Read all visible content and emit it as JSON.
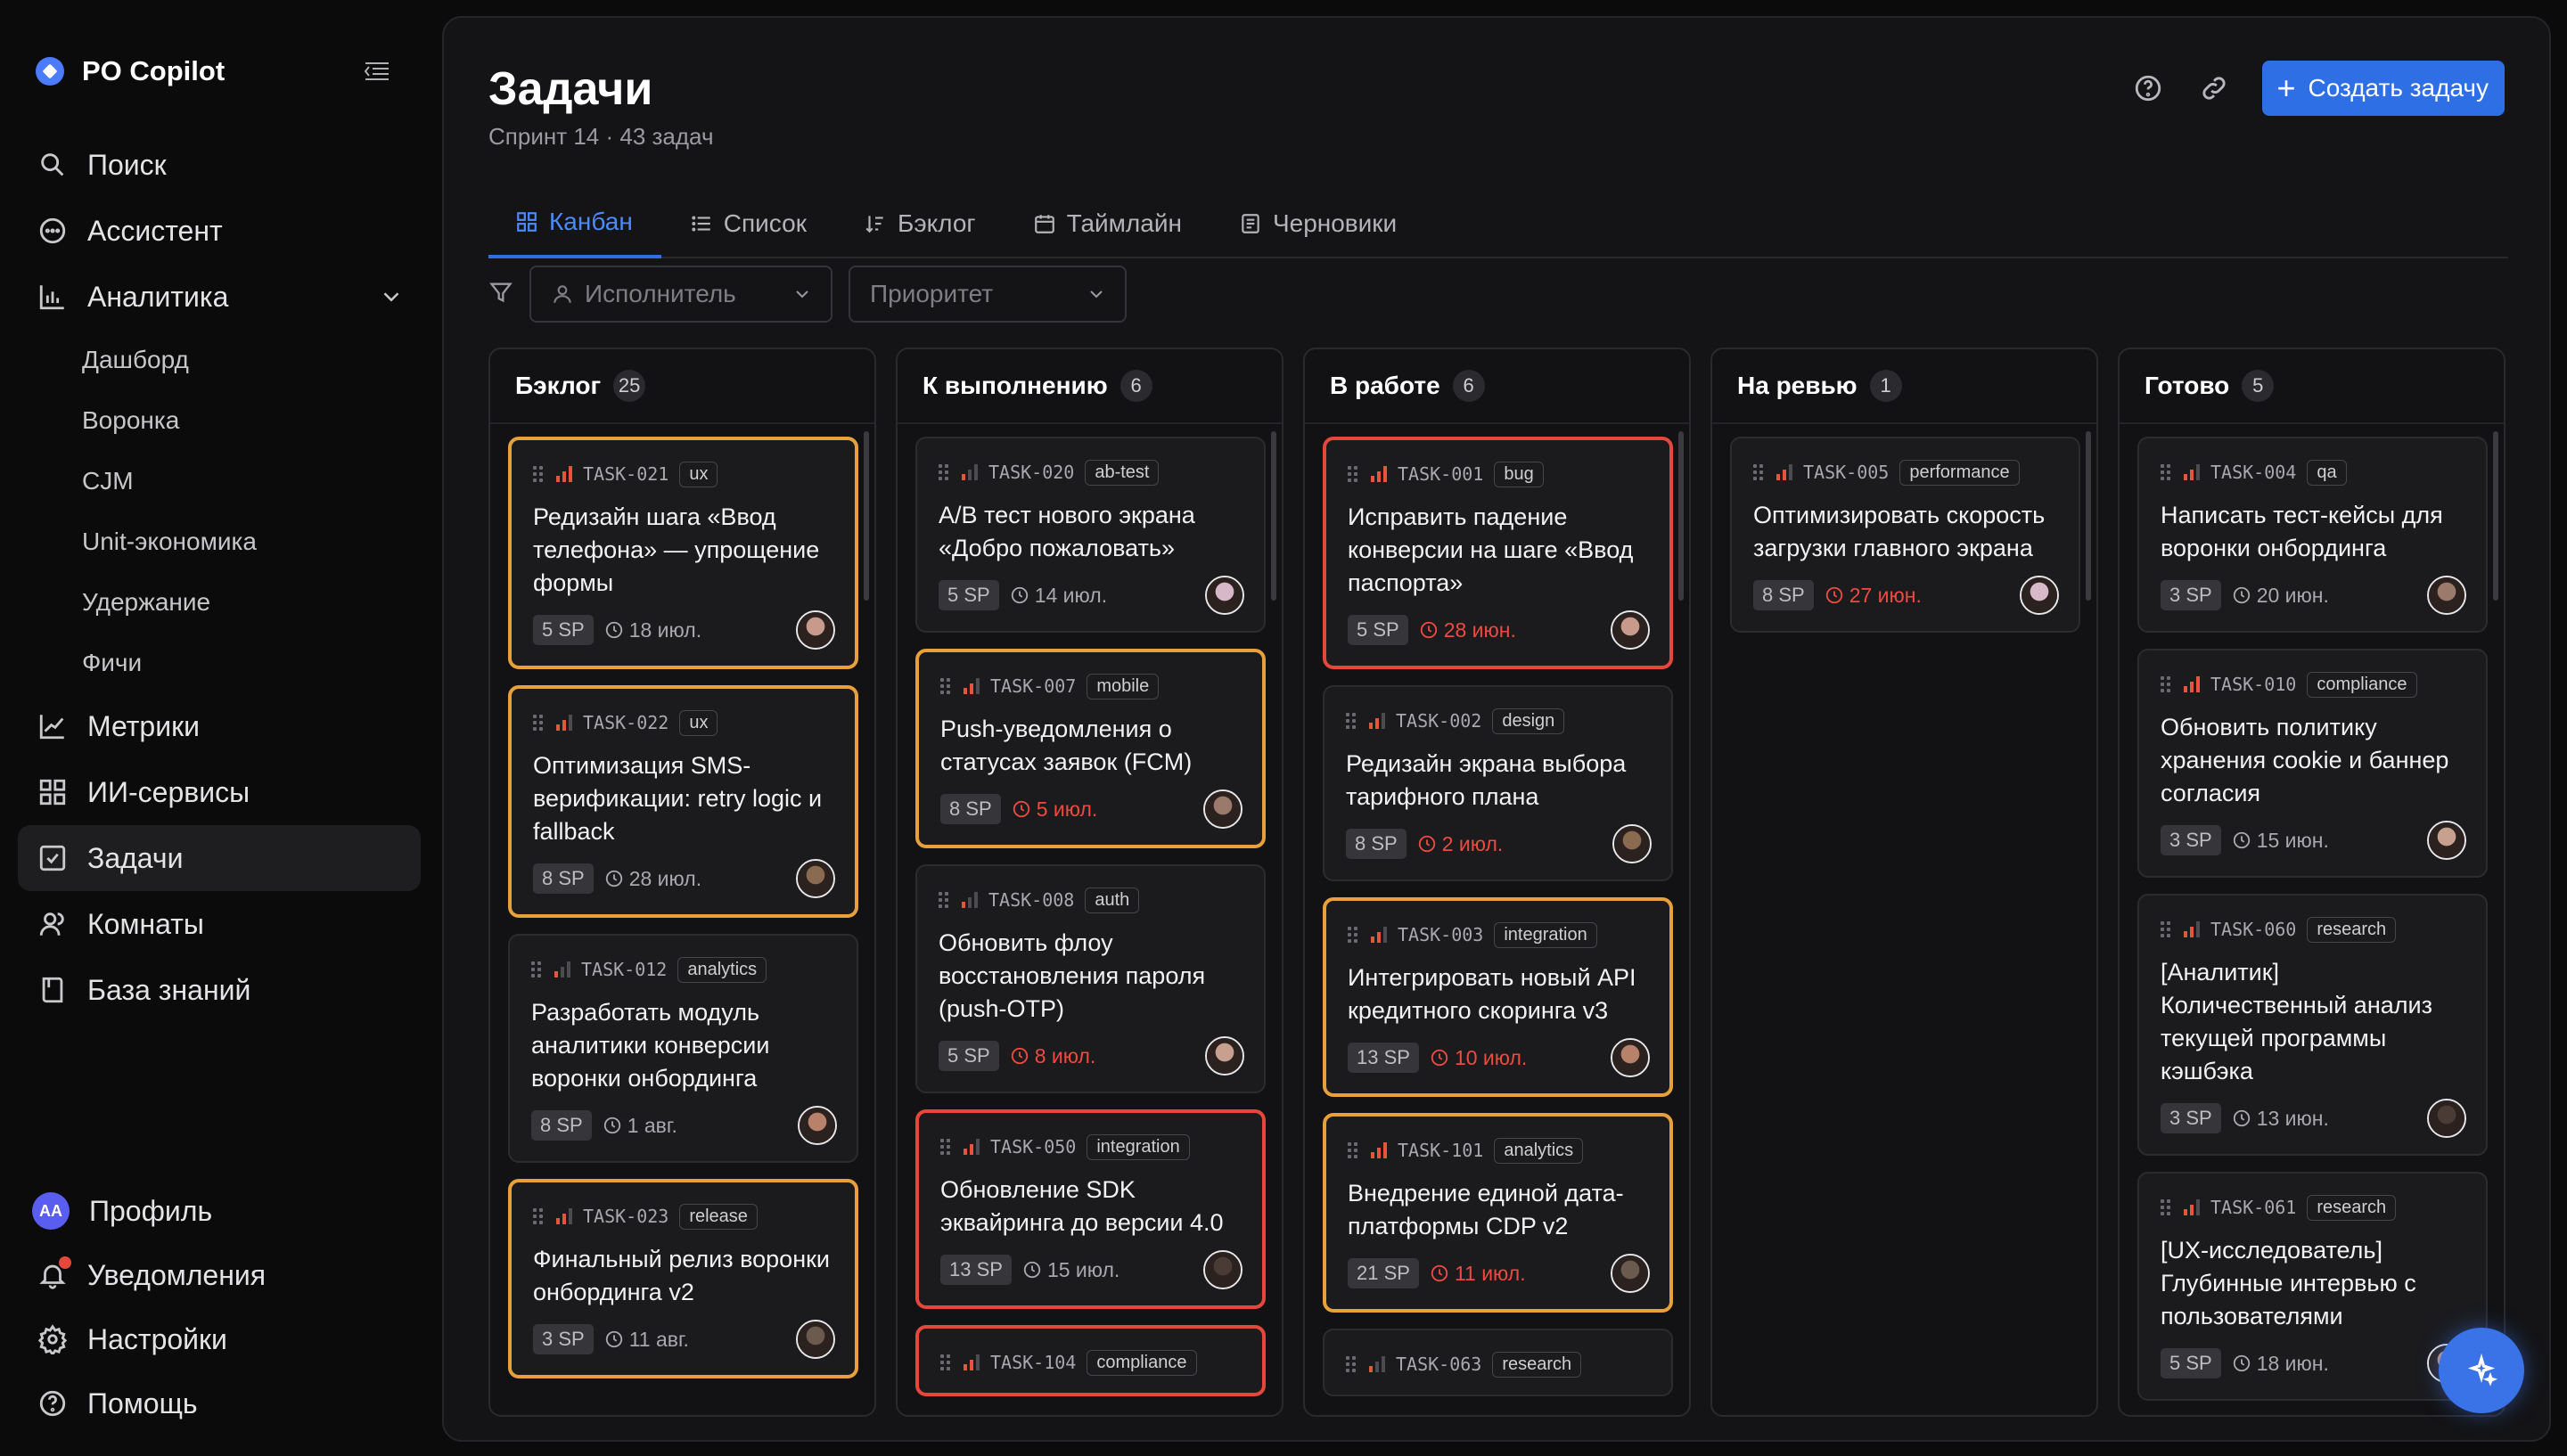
{
  "app": {
    "name": "PO Copilot"
  },
  "sidebar": {
    "items": [
      {
        "label": "Поиск",
        "icon": "search-icon"
      },
      {
        "label": "Ассистент",
        "icon": "chat-icon"
      },
      {
        "label": "Аналитика",
        "icon": "bar-chart-icon"
      }
    ],
    "analytics_sub": [
      "Дашборд",
      "Воронка",
      "CJM",
      "Unit-экономика",
      "Удержание",
      "Фичи"
    ],
    "items2": [
      {
        "label": "Метрики",
        "icon": "line-chart-icon"
      },
      {
        "label": "ИИ-сервисы",
        "icon": "grid-icon"
      },
      {
        "label": "Задачи",
        "icon": "checkbox-icon",
        "active": true
      },
      {
        "label": "Комнаты",
        "icon": "users-icon"
      },
      {
        "label": "База знаний",
        "icon": "book-icon"
      }
    ],
    "bottom": {
      "profile": "Профиль",
      "profile_initials": "AA",
      "notifications": "Уведомления",
      "settings": "Настройки",
      "help": "Помощь"
    }
  },
  "header": {
    "title": "Задачи",
    "subtitle": "Спринт 14 · 43 задач",
    "create_label": "Создать задачу"
  },
  "tabs": [
    "Канбан",
    "Список",
    "Бэклог",
    "Таймлайн",
    "Черновики"
  ],
  "active_tab": "Канбан",
  "filters": {
    "assignee_placeholder": "Исполнитель",
    "priority_placeholder": "Приоритет"
  },
  "columns": [
    {
      "title": "Бэклог",
      "count": "25",
      "cards": [
        {
          "id": "TASK-021",
          "tag": "ux",
          "priority": 3,
          "border": "orange",
          "title": "Редизайн шага «Ввод телефона» — упрощение формы",
          "sp": "5 SP",
          "due": "18 июл.",
          "overdue": false
        },
        {
          "id": "TASK-022",
          "tag": "ux",
          "priority": 2,
          "border": "orange",
          "title": "Оптимизация SMS-верификации: retry logic и fallback",
          "sp": "8 SP",
          "due": "28 июл.",
          "overdue": false
        },
        {
          "id": "TASK-012",
          "tag": "analytics",
          "priority": 1,
          "border": "none",
          "title": "Разработать модуль аналитики конверсии воронки онбординга",
          "sp": "8 SP",
          "due": "1 авг.",
          "overdue": false
        },
        {
          "id": "TASK-023",
          "tag": "release",
          "priority": 2,
          "border": "orange",
          "title": "Финальный релиз воронки онбординга v2",
          "sp": "3 SP",
          "due": "11 авг.",
          "overdue": false
        }
      ]
    },
    {
      "title": "К выполнению",
      "count": "6",
      "cards": [
        {
          "id": "TASK-020",
          "tag": "ab-test",
          "priority": 1,
          "border": "none",
          "title": "A/B тест нового экрана «Добро пожаловать»",
          "sp": "5 SP",
          "due": "14 июл.",
          "overdue": false
        },
        {
          "id": "TASK-007",
          "tag": "mobile",
          "priority": 2,
          "border": "orange",
          "title": "Push-уведомления о статусах заявок (FCM)",
          "sp": "8 SP",
          "due": "5 июл.",
          "overdue": true
        },
        {
          "id": "TASK-008",
          "tag": "auth",
          "priority": 1,
          "border": "none",
          "title": "Обновить флоу восстановления пароля (push-OTP)",
          "sp": "5 SP",
          "due": "8 июл.",
          "overdue": true
        },
        {
          "id": "TASK-050",
          "tag": "integration",
          "priority": 2,
          "border": "red",
          "title": "Обновление SDK эквайринга до версии 4.0",
          "sp": "13 SP",
          "due": "15 июл.",
          "overdue": false
        },
        {
          "id": "TASK-104",
          "tag": "compliance",
          "priority": 2,
          "border": "red",
          "title": "",
          "sp": "",
          "due": "",
          "overdue": false
        }
      ]
    },
    {
      "title": "В работе",
      "count": "6",
      "cards": [
        {
          "id": "TASK-001",
          "tag": "bug",
          "priority": 3,
          "border": "red",
          "title": "Исправить падение конверсии на шаге «Ввод паспорта»",
          "sp": "5 SP",
          "due": "28 июн.",
          "overdue": true
        },
        {
          "id": "TASK-002",
          "tag": "design",
          "priority": 2,
          "border": "none",
          "title": "Редизайн экрана выбора тарифного плана",
          "sp": "8 SP",
          "due": "2 июл.",
          "overdue": true
        },
        {
          "id": "TASK-003",
          "tag": "integration",
          "priority": 2,
          "border": "orange",
          "title": "Интегрировать новый API кредитного скоринга v3",
          "sp": "13 SP",
          "due": "10 июл.",
          "overdue": true
        },
        {
          "id": "TASK-101",
          "tag": "analytics",
          "priority": 3,
          "border": "orange",
          "title": "Внедрение единой дата-платформы CDP v2",
          "sp": "21 SP",
          "due": "11 июл.",
          "overdue": true
        },
        {
          "id": "TASK-063",
          "tag": "research",
          "priority": 1,
          "border": "none",
          "title": "",
          "sp": "",
          "due": "",
          "overdue": false
        }
      ]
    },
    {
      "title": "На ревью",
      "count": "1",
      "cards": [
        {
          "id": "TASK-005",
          "tag": "performance",
          "priority": 2,
          "border": "none",
          "title": "Оптимизировать скорость загрузки главного экрана",
          "sp": "8 SP",
          "due": "27 июн.",
          "overdue": true
        }
      ]
    },
    {
      "title": "Готово",
      "count": "5",
      "cards": [
        {
          "id": "TASK-004",
          "tag": "qa",
          "priority": 2,
          "border": "none",
          "title": "Написать тест-кейсы для воронки онбординга",
          "sp": "3 SP",
          "due": "20 июн.",
          "overdue": false
        },
        {
          "id": "TASK-010",
          "tag": "compliance",
          "priority": 3,
          "border": "none",
          "title": "Обновить политику хранения cookie и баннер согласия",
          "sp": "3 SP",
          "due": "15 июн.",
          "overdue": false
        },
        {
          "id": "TASK-060",
          "tag": "research",
          "priority": 2,
          "border": "none",
          "title": "[Аналитик] Количественный анализ текущей программы кэшбэка",
          "sp": "3 SP",
          "due": "13 июн.",
          "overdue": false
        },
        {
          "id": "TASK-061",
          "tag": "research",
          "priority": 2,
          "border": "none",
          "title": "[UX-исследователь] Глубинные интервью с пользователями",
          "sp": "5 SP",
          "due": "18 июн.",
          "overdue": false
        }
      ]
    }
  ],
  "colors": {
    "accent": "#2f6fe6",
    "overdue": "#ef4a3f",
    "warning_border": "#e7a03a",
    "critical_border": "#e5483b"
  }
}
